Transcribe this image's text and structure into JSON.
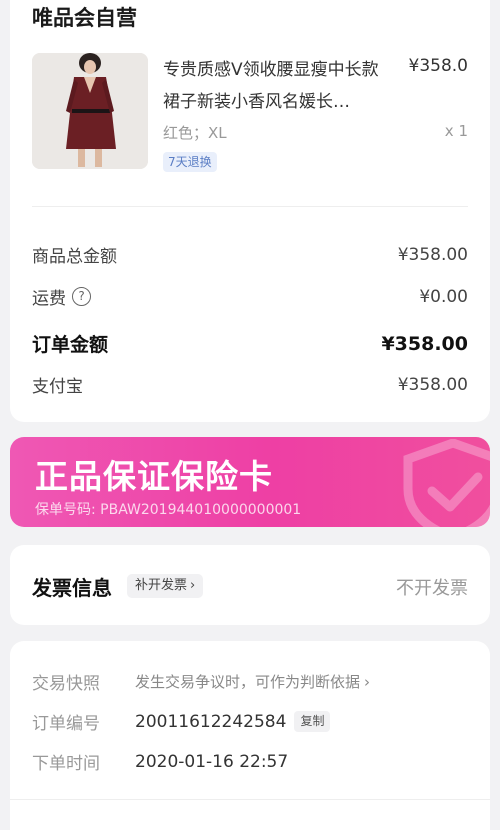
{
  "order": {
    "store_name": "唯品会自营",
    "product": {
      "title": "专贵质感V领收腰显瘦中长款裙子新装小香风名媛长…",
      "price": "¥358.0",
      "spec": "红色；XL",
      "quantity": "x 1",
      "return_badge": "7天退换"
    },
    "summary": {
      "subtotal_label": "商品总金额",
      "subtotal_value": "¥358.00",
      "shipping_label": "运费",
      "shipping_value": "¥0.00",
      "total_label": "订单金额",
      "total_value": "¥358.00",
      "payment_label": "支付宝",
      "payment_value": "¥358.00"
    }
  },
  "insurance": {
    "title": "正品保证保险卡",
    "policy_number": "保单号码: PBAW201944010000000001"
  },
  "invoice": {
    "title": "发票信息",
    "button_label": "补开发票",
    "value": "不开发票"
  },
  "details": {
    "snapshot_label": "交易快照",
    "snapshot_value": "发生交易争议时，可作为判断依据",
    "order_no_label": "订单编号",
    "order_no_value": "20011612242584",
    "copy_label": "复制",
    "order_time_label": "下单时间",
    "order_time_value": "2020-01-16 22:57"
  },
  "colors": {
    "accent_pink": "#ee3fa4",
    "badge_blue": "#5a7dc4",
    "page_bg": "#f2f2f4"
  }
}
